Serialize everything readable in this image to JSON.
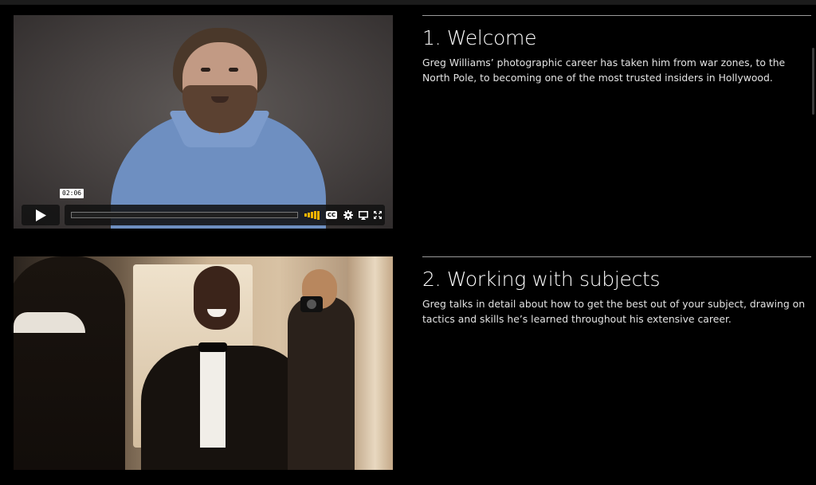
{
  "lessons": [
    {
      "title": "1. Welcome",
      "description": "Greg Williams’ photographic career has taken him from war zones, to the North Pole, to becoming one of the most trusted insiders in Hollywood.",
      "video": {
        "time_tooltip": "02:06",
        "progress_fraction": 0.0,
        "cc_label": "CC",
        "controls": [
          "play-icon",
          "volume-icon",
          "cc-icon",
          "gear-icon",
          "airplay-icon",
          "fullscreen-icon"
        ]
      }
    },
    {
      "title": "2. Working with subjects",
      "description": "Greg talks in detail about how to get the best out of your subject, drawing on tactics and skills he’s learned throughout his extensive career."
    }
  ],
  "colors": {
    "background": "#000000",
    "divider": "#9a9a9a",
    "volume_accent": "#f4b400"
  }
}
